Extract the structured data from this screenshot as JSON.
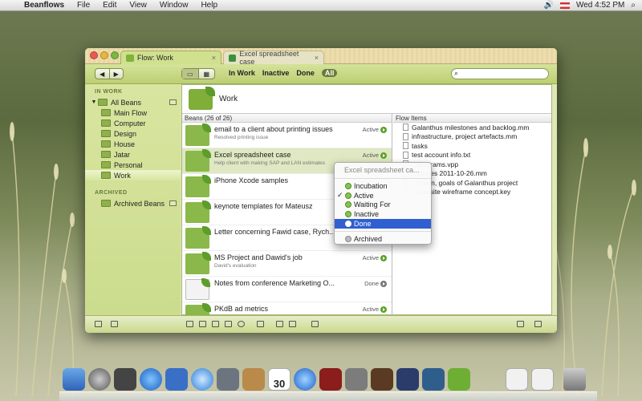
{
  "menubar": {
    "app_name": "Beanflows",
    "menus": [
      "File",
      "Edit",
      "View",
      "Window",
      "Help"
    ],
    "clock": "Wed 4:52 PM"
  },
  "tabs": [
    {
      "label": "Flow: Work",
      "close": "×"
    },
    {
      "label": "Excel spreadsheet case",
      "close": "×"
    }
  ],
  "toolbar": {
    "nav_back": "◀",
    "nav_forward": "▶",
    "filters": [
      "In Work",
      "Inactive",
      "Done",
      "All"
    ],
    "search_placeholder": ""
  },
  "sidebar": {
    "sections": [
      {
        "title": "IN WORK",
        "items": [
          "All Beans",
          "Main Flow",
          "Computer",
          "Design",
          "House",
          "Jatar",
          "Personal",
          "Work"
        ]
      },
      {
        "title": "ARCHIVED",
        "items": [
          "Archived Beans"
        ]
      }
    ]
  },
  "content": {
    "flow_title": "Work",
    "beans_header": "Beans (26 of 26)",
    "items_header": "Flow Items"
  },
  "beans": [
    {
      "title": "email to a client about printing issues",
      "sub": "Resolved printing issue",
      "status": "Active"
    },
    {
      "title": "Excel spreadsheet case",
      "sub": "Help client with making SAP and LAN estimates",
      "status": "Active"
    },
    {
      "title": "iPhone Xcode samples",
      "sub": "",
      "status": ""
    },
    {
      "title": "keynote templates for Mateusz",
      "sub": "",
      "status": ""
    },
    {
      "title": "Letter concerning Fawid case, Rych...",
      "sub": "",
      "status": ""
    },
    {
      "title": "MS Project and Dawid's job",
      "sub": "David's evaluation",
      "status": "Active"
    },
    {
      "title": "Notes from conference Marketing O...",
      "sub": "",
      "status": "Done"
    },
    {
      "title": "PKdB ad metrics",
      "sub": "",
      "status": "Active"
    }
  ],
  "flow_items": [
    "Galanthus milestones and backlog.mm",
    "infrastructure, project artefacts.mm",
    "tasks",
    "test account info.txt",
    "...diagrams.vpp",
    "...stories 2011-10-26.mm",
    "...vision, goals of Galanthus project",
    "...website wireframe concept.key"
  ],
  "context_menu": {
    "header": "Excel spreadsheet ca...",
    "options": [
      "Incubation",
      "Active",
      "Waiting For",
      "Inactive",
      "Done"
    ],
    "archived": "Archived",
    "checked": "Active",
    "highlighted": "Done",
    "check_mark": "✓"
  },
  "colors": {
    "accent_green": "#58a32a",
    "menu_highlight": "#2f5fd0",
    "window_bg": "#dfe7b6"
  },
  "dock": {
    "calendar_day": "30"
  }
}
